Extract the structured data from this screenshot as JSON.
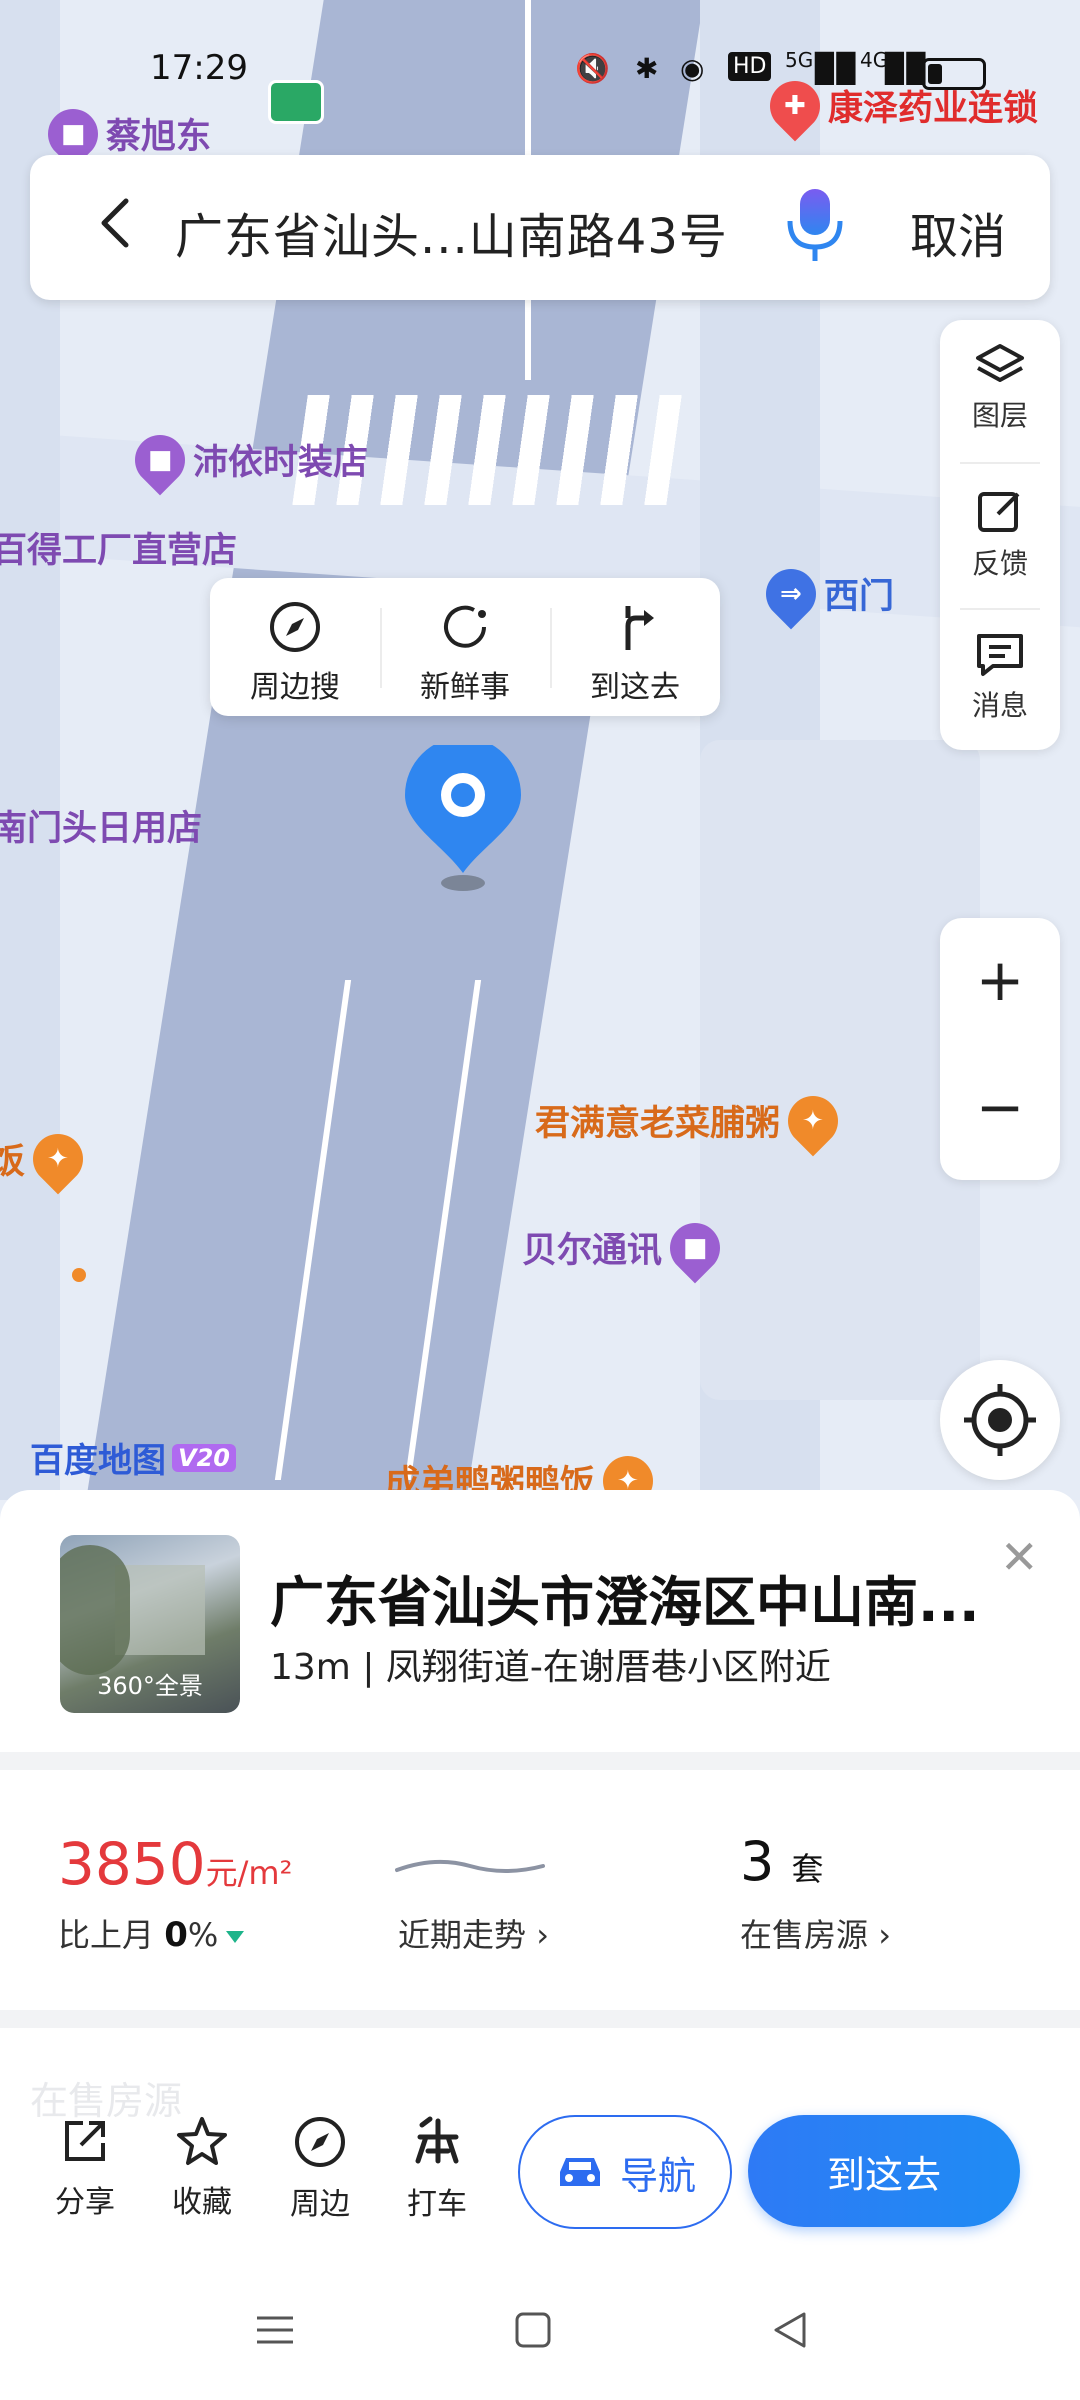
{
  "status_bar": {
    "time": "17:29",
    "network": "5G",
    "network2": "4G",
    "hd": "HD"
  },
  "search": {
    "query": "广东省汕头...山南路43号",
    "cancel_label": "取消"
  },
  "map": {
    "pois": {
      "p1": "蔡旭东",
      "p2": "康泽药业连锁",
      "p3": "沛依时装店",
      "p4": "百得工厂直营店",
      "p5": "西门",
      "p6": "南门头日用店",
      "p7": "君满意老菜脯粥",
      "p8": "贝尔通讯",
      "p9": "成弟鸭粥鸭饭",
      "p10": "饭"
    },
    "logo": "百度地图",
    "logo_version": "V20"
  },
  "popup": {
    "nearby": "周边搜",
    "news": "新鲜事",
    "go_here": "到这去"
  },
  "tools": {
    "layers": "图层",
    "feedback": "反馈",
    "messages": "消息"
  },
  "place": {
    "title": "广东省汕头市澄海区中山南...",
    "subtitle": "13m | 凤翔街道-在谢厝巷小区附近",
    "thumb_label": "360°全景"
  },
  "stats": {
    "price": "3850",
    "price_unit": "元/m²",
    "mom_label": "比上月",
    "mom_value": "0",
    "mom_unit": "%",
    "trend_label": "近期走势",
    "houses_count": "3",
    "houses_unit": "套",
    "houses_label": "在售房源"
  },
  "ghost_text": "在售房源",
  "actions": {
    "share": "分享",
    "favorite": "收藏",
    "nearby": "周边",
    "taxi": "打车",
    "navigate": "导航",
    "go_here": "到这去"
  },
  "colors": {
    "accent": "#2d6cf0",
    "price_red": "#e4393c",
    "pin_blue": "#2f86f0"
  }
}
